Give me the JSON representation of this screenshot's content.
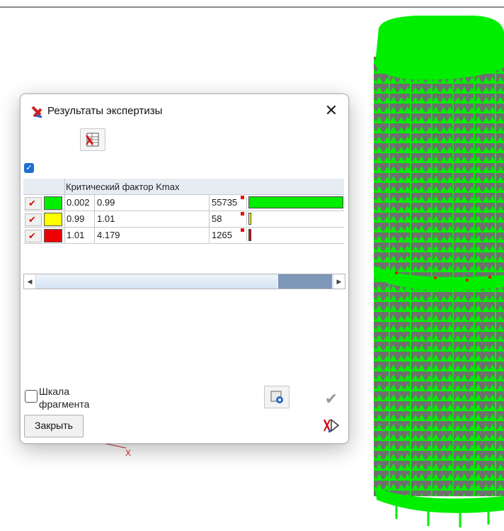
{
  "window": {
    "title": "Результаты экспертизы",
    "close_glyph": "✕"
  },
  "toolbar": {
    "icon": "table-report-icon"
  },
  "filter_checkbox": {
    "checked": true
  },
  "grid": {
    "header": "Критический фактор Kmax",
    "rows": [
      {
        "enabled": true,
        "color": "#00ee00",
        "from": "0.002",
        "to": "0.99",
        "count": "55735",
        "fill": 1.0
      },
      {
        "enabled": true,
        "color": "#ffff00",
        "from": "0.99",
        "to": "1.01",
        "count": "58",
        "fill": 0.001
      },
      {
        "enabled": true,
        "color": "#ee0000",
        "from": "1.01",
        "to": "4.179",
        "count": "1265",
        "fill": 0.023
      }
    ]
  },
  "scale_option": {
    "label": "Шкала фрагмента",
    "checked": false
  },
  "buttons": {
    "close_label": "Закрыть",
    "settings_icon": "settings-icon",
    "apply_icon": "checkmark-icon",
    "expert_icon": "expert-icon"
  },
  "viewport": {
    "axis_label": "X"
  },
  "colors": {
    "model_green": "#00ee00",
    "model_gray": "#6f6f6f",
    "highlight_red": "#ee0000",
    "scroll_thumb": "#7c97b7"
  }
}
